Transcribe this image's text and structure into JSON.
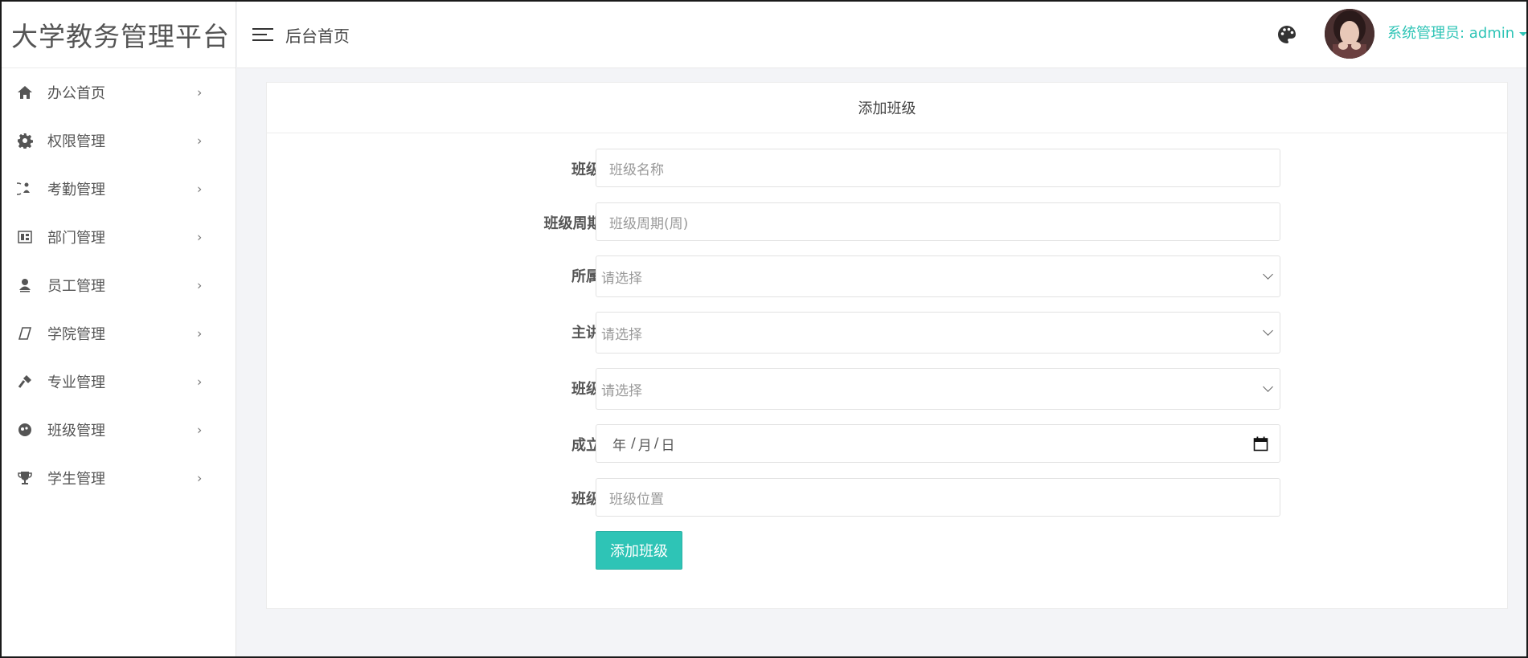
{
  "app": {
    "title": "大学教务管理平台"
  },
  "header": {
    "title": "后台首页",
    "user_label": "系统管理员: admin"
  },
  "sidebar": {
    "items": [
      {
        "label": "办公首页",
        "icon": "home-icon"
      },
      {
        "label": "权限管理",
        "icon": "gear-icon"
      },
      {
        "label": "考勤管理",
        "icon": "attendance-icon"
      },
      {
        "label": "部门管理",
        "icon": "department-icon"
      },
      {
        "label": "员工管理",
        "icon": "user-icon"
      },
      {
        "label": "学院管理",
        "icon": "college-icon"
      },
      {
        "label": "专业管理",
        "icon": "major-icon"
      },
      {
        "label": "班级管理",
        "icon": "class-icon"
      },
      {
        "label": "学生管理",
        "icon": "trophy-icon"
      }
    ],
    "arrow": "›"
  },
  "card": {
    "title": "添加班级"
  },
  "form": {
    "class_name": {
      "label": "班级名称",
      "placeholder": "班级名称",
      "value": ""
    },
    "class_period": {
      "label": "班级周期(周)",
      "placeholder": "班级周期(周)",
      "value": ""
    },
    "major": {
      "label": "所属专业",
      "selected": "请选择"
    },
    "teacher": {
      "label": "主讲老师",
      "selected": "请选择"
    },
    "counselor": {
      "label": "班级导员",
      "selected": "请选择"
    },
    "founded": {
      "label": "成立时间",
      "year": "年",
      "month": "月",
      "day": "日",
      "sep": "/"
    },
    "location": {
      "label": "班级位置",
      "placeholder": "班级位置",
      "value": ""
    },
    "submit_label": "添加班级"
  },
  "colors": {
    "accent": "#2ec4b6",
    "background": "#f3f4f7",
    "text": "#555555"
  }
}
